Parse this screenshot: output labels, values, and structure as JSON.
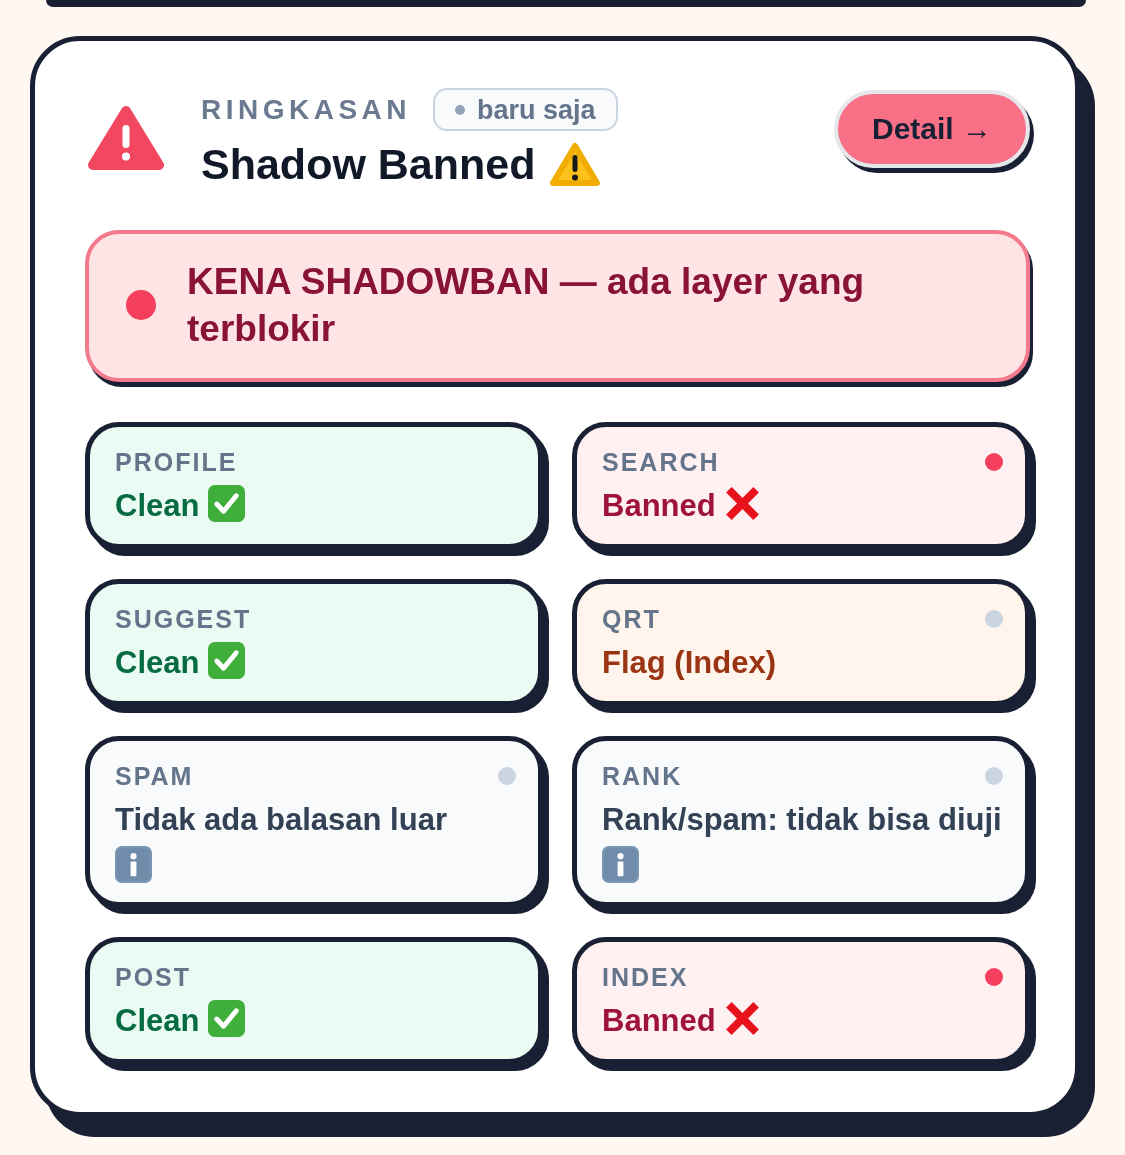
{
  "summary": {
    "eyebrow": "RINGKASAN",
    "time_badge": "baru saja",
    "title": "Shadow Banned",
    "button": "Detail →"
  },
  "alert": {
    "kind": "danger",
    "text": "KENA SHADOWBAN — ada layer yang terblokir"
  },
  "layers": [
    {
      "label": "PROFILE",
      "kind": "clean",
      "value": "Clean"
    },
    {
      "label": "SEARCH",
      "kind": "banned",
      "value": "Banned",
      "color": "#f43f5e"
    },
    {
      "label": "SUGGEST",
      "kind": "clean",
      "value": "Clean"
    },
    {
      "label": "QRT",
      "kind": "flag",
      "value": "Flag (Index)",
      "color": "#cbd5e1"
    },
    {
      "label": "SPAM",
      "kind": "info",
      "value": "Tidak ada balasan luar",
      "color": "#cbd5e1"
    },
    {
      "label": "RANK",
      "kind": "info",
      "value": "Rank/spam: tidak bisa diuji",
      "color": "#cbd5e1"
    },
    {
      "label": "POST",
      "kind": "clean",
      "value": "Clean"
    },
    {
      "label": "INDEX",
      "kind": "banned",
      "value": "Banned",
      "color": "#f43f5e"
    }
  ]
}
